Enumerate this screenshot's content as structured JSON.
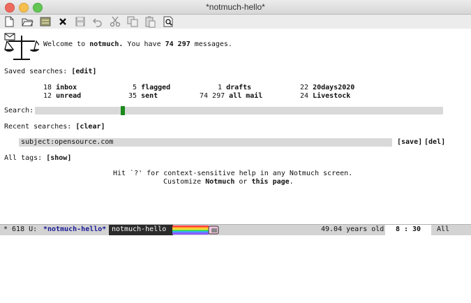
{
  "window": {
    "title": "*notmuch-hello*"
  },
  "toolbar": {
    "icons": [
      "new-file-icon",
      "open-folder-icon",
      "save-archive-icon",
      "close-icon",
      "save-disk-icon",
      "undo-icon",
      "cut-icon",
      "copy-icon",
      "paste-icon",
      "search-doc-icon"
    ]
  },
  "welcome": {
    "prefix": "Welcome to ",
    "app": "notmuch.",
    "middle": " You have ",
    "count": "74 297",
    "suffix": " messages."
  },
  "saved": {
    "label": "Saved searches: ",
    "edit": "[edit]",
    "items": [
      {
        "count": "18",
        "name": "inbox"
      },
      {
        "count": "5",
        "name": "flagged"
      },
      {
        "count": "1",
        "name": "drafts"
      },
      {
        "count": "22",
        "name": "20days2020"
      },
      {
        "count": "12",
        "name": "unread"
      },
      {
        "count": "35",
        "name": "sent"
      },
      {
        "count": "74 297",
        "name": "all mail"
      },
      {
        "count": "24",
        "name": "Livestock"
      }
    ]
  },
  "search": {
    "label": "Search: "
  },
  "recent": {
    "label": "Recent searches: ",
    "clear": "[clear]",
    "query": "subject:opensource.com",
    "save": "[save]",
    "del": "[del]"
  },
  "tags": {
    "label": "All tags: ",
    "show": "[show]"
  },
  "help": {
    "line1": "Hit `?' for context-sensitive help in any Notmuch screen.",
    "line2_a": "Customize ",
    "line2_b": "Notmuch",
    "line2_c": " or ",
    "line2_d": "this page",
    "line2_e": "."
  },
  "modeline": {
    "status": "* 618 U:",
    "buffer": "*notmuch-hello*",
    "mode": "notmuch-hello",
    "age": "49.04 years old",
    "pos": "8 : 30",
    "all": "All"
  }
}
